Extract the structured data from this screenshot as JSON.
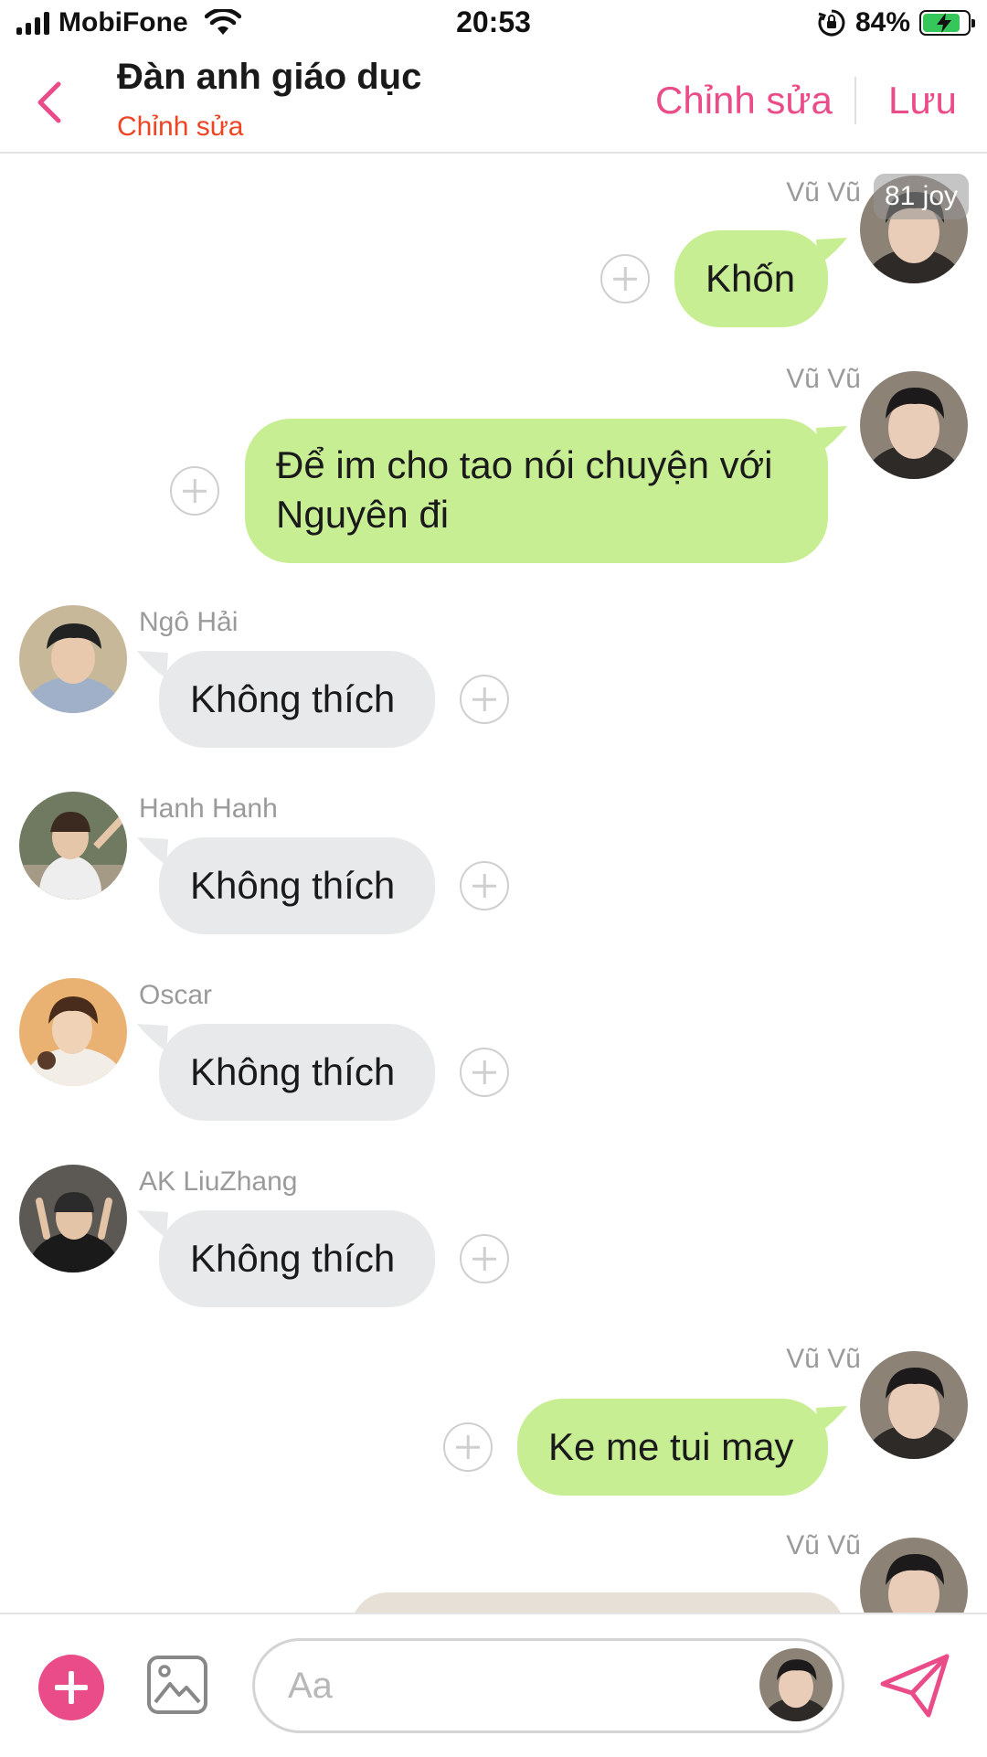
{
  "status_bar": {
    "carrier": "MobiFone",
    "time": "20:53",
    "battery_percent": "84%",
    "battery_level": 0.84,
    "charging": true,
    "icons": [
      "signal-icon",
      "wifi-icon",
      "rotation-lock-icon",
      "battery-icon"
    ]
  },
  "header": {
    "title": "Đàn anh giáo dục",
    "subtitle": "Chỉnh sửa",
    "edit_label": "Chỉnh sửa",
    "save_label": "Lưu"
  },
  "chat": {
    "badge": "81 joy",
    "messages": [
      {
        "side": "out",
        "sender": "Vũ Vũ",
        "text": "Khốn"
      },
      {
        "side": "out",
        "sender": "Vũ Vũ",
        "text": "Để im cho tao nói chuyện với Nguyên đi"
      },
      {
        "side": "in",
        "sender": "Ngô Hải",
        "text": "Không thích"
      },
      {
        "side": "in",
        "sender": "Hanh Hanh",
        "text": "Không thích"
      },
      {
        "side": "in",
        "sender": "Oscar",
        "text": "Không thích"
      },
      {
        "side": "in",
        "sender": "AK LiuZhang",
        "text": "Không thích"
      },
      {
        "side": "out",
        "sender": "Vũ Vũ",
        "text": "Ke me tui may"
      },
      {
        "side": "out",
        "sender": "Vũ Vũ",
        "text": ""
      }
    ]
  },
  "composer": {
    "placeholder": "Aa",
    "value": ""
  },
  "colors": {
    "accent": "#ea4c89",
    "subtitle": "#ee4422",
    "bubble_out": "#c8ee94",
    "bubble_in": "#e8e9eb"
  }
}
